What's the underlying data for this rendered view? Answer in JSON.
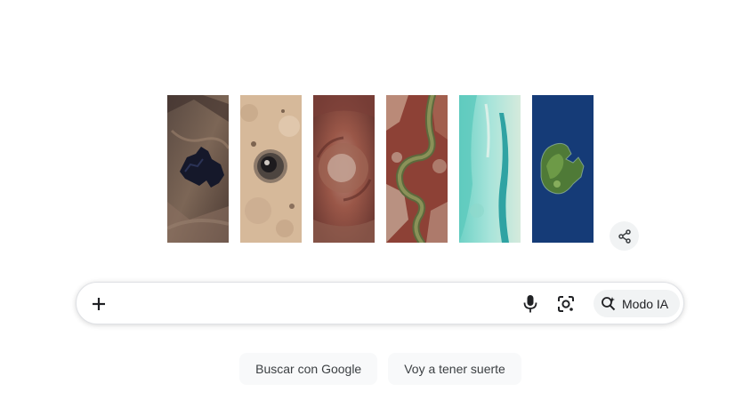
{
  "doodle": {
    "tiles": [
      {
        "name": "doodle-tile-crater-lake"
      },
      {
        "name": "doodle-tile-desert-crater"
      },
      {
        "name": "doodle-tile-red-dome"
      },
      {
        "name": "doodle-tile-winding-river"
      },
      {
        "name": "doodle-tile-turquoise-lagoon"
      },
      {
        "name": "doodle-tile-green-island"
      }
    ],
    "share_icon": "share-icon"
  },
  "search": {
    "value": "",
    "placeholder": "",
    "plus_icon": "plus-icon",
    "mic_icon": "microphone-icon",
    "lens_icon": "lens-camera-icon",
    "ai_mode": {
      "icon": "ai-search-sparkle-icon",
      "label": "Modo IA"
    }
  },
  "buttons": {
    "search_label": "Buscar con Google",
    "lucky_label": "Voy a tener suerte"
  },
  "colors": {
    "google_blue": "#4285f4",
    "google_red": "#ea4335",
    "google_yellow": "#fbbc05",
    "google_green": "#34a853",
    "icon_dark": "#202124",
    "button_bg": "#f8f9fa"
  }
}
